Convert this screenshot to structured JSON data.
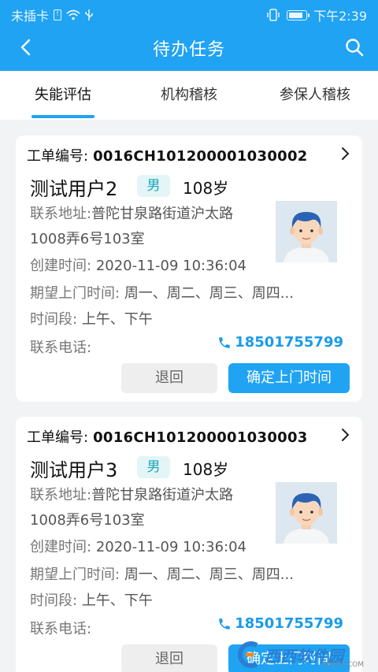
{
  "status_bar": {
    "carrier": "未插卡",
    "time": "下午2:39"
  },
  "header": {
    "title": "待办任务",
    "background": "#20a3f3"
  },
  "tabs": [
    {
      "label": "失能评估",
      "active": true
    },
    {
      "label": "机构稽核",
      "active": false
    },
    {
      "label": "参保人稽核",
      "active": false
    }
  ],
  "cards": [
    {
      "order_label": "工单编号:",
      "order_no": "0016CH101200001030002",
      "name": "测试用户2",
      "gender": "男",
      "age": "108岁",
      "address_label": "联系地址:",
      "address": "普陀甘泉路街道沪太路1008弄6号103室",
      "created_label": "创建时间:",
      "created": "2020-11-09 10:36:04",
      "expect_label": "期望上门时间:",
      "expect": "周一、周二、周三、周四...",
      "period_label": "时间段:",
      "period": "上午、下午",
      "phone_label": "联系电话:",
      "phone": "18501755799",
      "return_label": "退回",
      "confirm_label": "确定上门时间"
    },
    {
      "order_label": "工单编号:",
      "order_no": "0016CH101200001030003",
      "name": "测试用户3",
      "gender": "男",
      "age": "108岁",
      "address_label": "联系地址:",
      "address": "普陀甘泉路街道沪太路1008弄6号103室",
      "created_label": "创建时间:",
      "created": "2020-11-09 10:36:04",
      "expect_label": "期望上门时间:",
      "expect": "周一、周二、周三、周四...",
      "period_label": "时间段:",
      "period": "上午、下午",
      "phone_label": "联系电话:",
      "phone": "18501755799",
      "return_label": "退回",
      "confirm_label": "确定上门时间"
    }
  ],
  "watermark": {
    "brand": "西西软件园",
    "site": "CR173.COM"
  }
}
